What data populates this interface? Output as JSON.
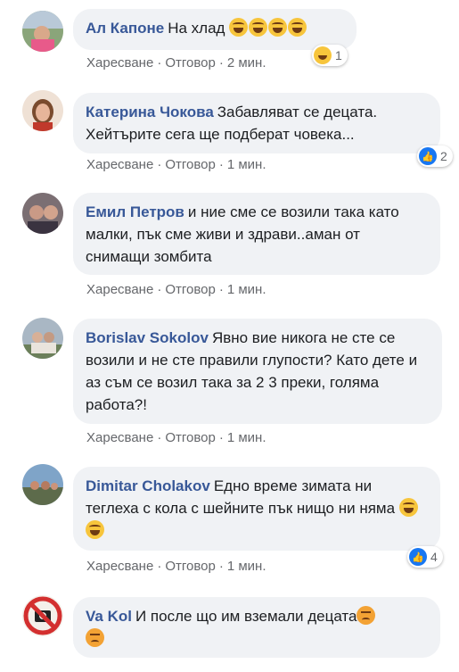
{
  "actions": {
    "like": "Харесване",
    "reply": "Отговор",
    "sep": "·"
  },
  "comments": [
    {
      "author": "Ал Капоне",
      "text": "На хлад",
      "emojis": [
        "laugh",
        "laugh",
        "laugh",
        "laugh"
      ],
      "time": "2 мин.",
      "reaction": {
        "type": "haha",
        "count": "1"
      }
    },
    {
      "author": "Катерина Чокова",
      "text": "Забавляват се децата. Хейтърите сега ще подберат човека...",
      "emojis": [],
      "time": "1 мин.",
      "reaction": {
        "type": "like",
        "count": "2"
      }
    },
    {
      "author": "Емил Петров",
      "text": "и ние сме се возили така като малки, пък сме живи и здрави..аман от снимащи зомбита",
      "emojis": [],
      "time": "1 мин.",
      "reaction": null
    },
    {
      "author": "Borislav Sokolov",
      "text": "Явно вие никога не сте се возили и не сте правили глупости? Като дете и аз съм се возил така за 2 3 преки, голяма работа?!",
      "emojis": [],
      "time": "1 мин.",
      "reaction": null
    },
    {
      "author": "Dimitar Cholakov",
      "text": "Едно време зимата ни теглеха с кола с шейните пък нищо ни няма",
      "emojis": [
        "laugh",
        "laugh"
      ],
      "time": "1 мин.",
      "reaction": {
        "type": "like",
        "count": "4"
      }
    },
    {
      "author": "Va Kol",
      "text": "И после що им вземали децата",
      "emojis": [
        "angry",
        "angry"
      ],
      "time": "",
      "reaction": null
    }
  ]
}
